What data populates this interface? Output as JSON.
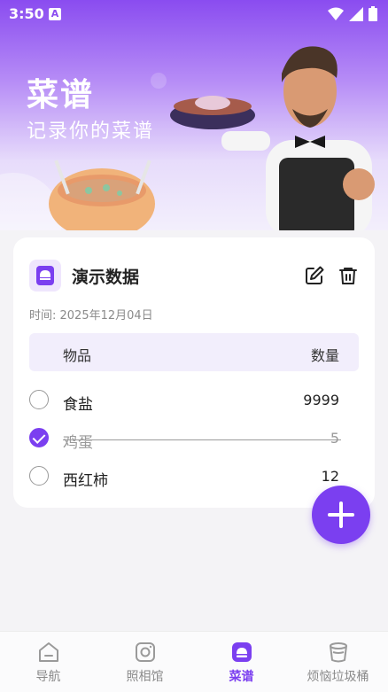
{
  "status": {
    "time": "3:50"
  },
  "hero": {
    "title": "菜谱",
    "subtitle": "记录你的菜谱"
  },
  "card": {
    "title": "演示数据",
    "time_label": "时间: 2025年12月04日",
    "header": {
      "item": "物品",
      "qty": "数量"
    },
    "rows": [
      {
        "name": "食盐",
        "qty": "9999",
        "checked": false
      },
      {
        "name": "鸡蛋",
        "qty": "5",
        "checked": true
      },
      {
        "name": "西红柿",
        "qty": "12",
        "checked": false
      }
    ]
  },
  "nav": {
    "items": [
      {
        "label": "导航",
        "icon": "home-icon"
      },
      {
        "label": "照相馆",
        "icon": "camera-icon"
      },
      {
        "label": "菜谱",
        "icon": "recipe-icon"
      },
      {
        "label": "烦恼垃圾桶",
        "icon": "trash-bin-icon"
      }
    ],
    "active": "菜谱"
  },
  "colors": {
    "accent": "#7b3ff0"
  }
}
